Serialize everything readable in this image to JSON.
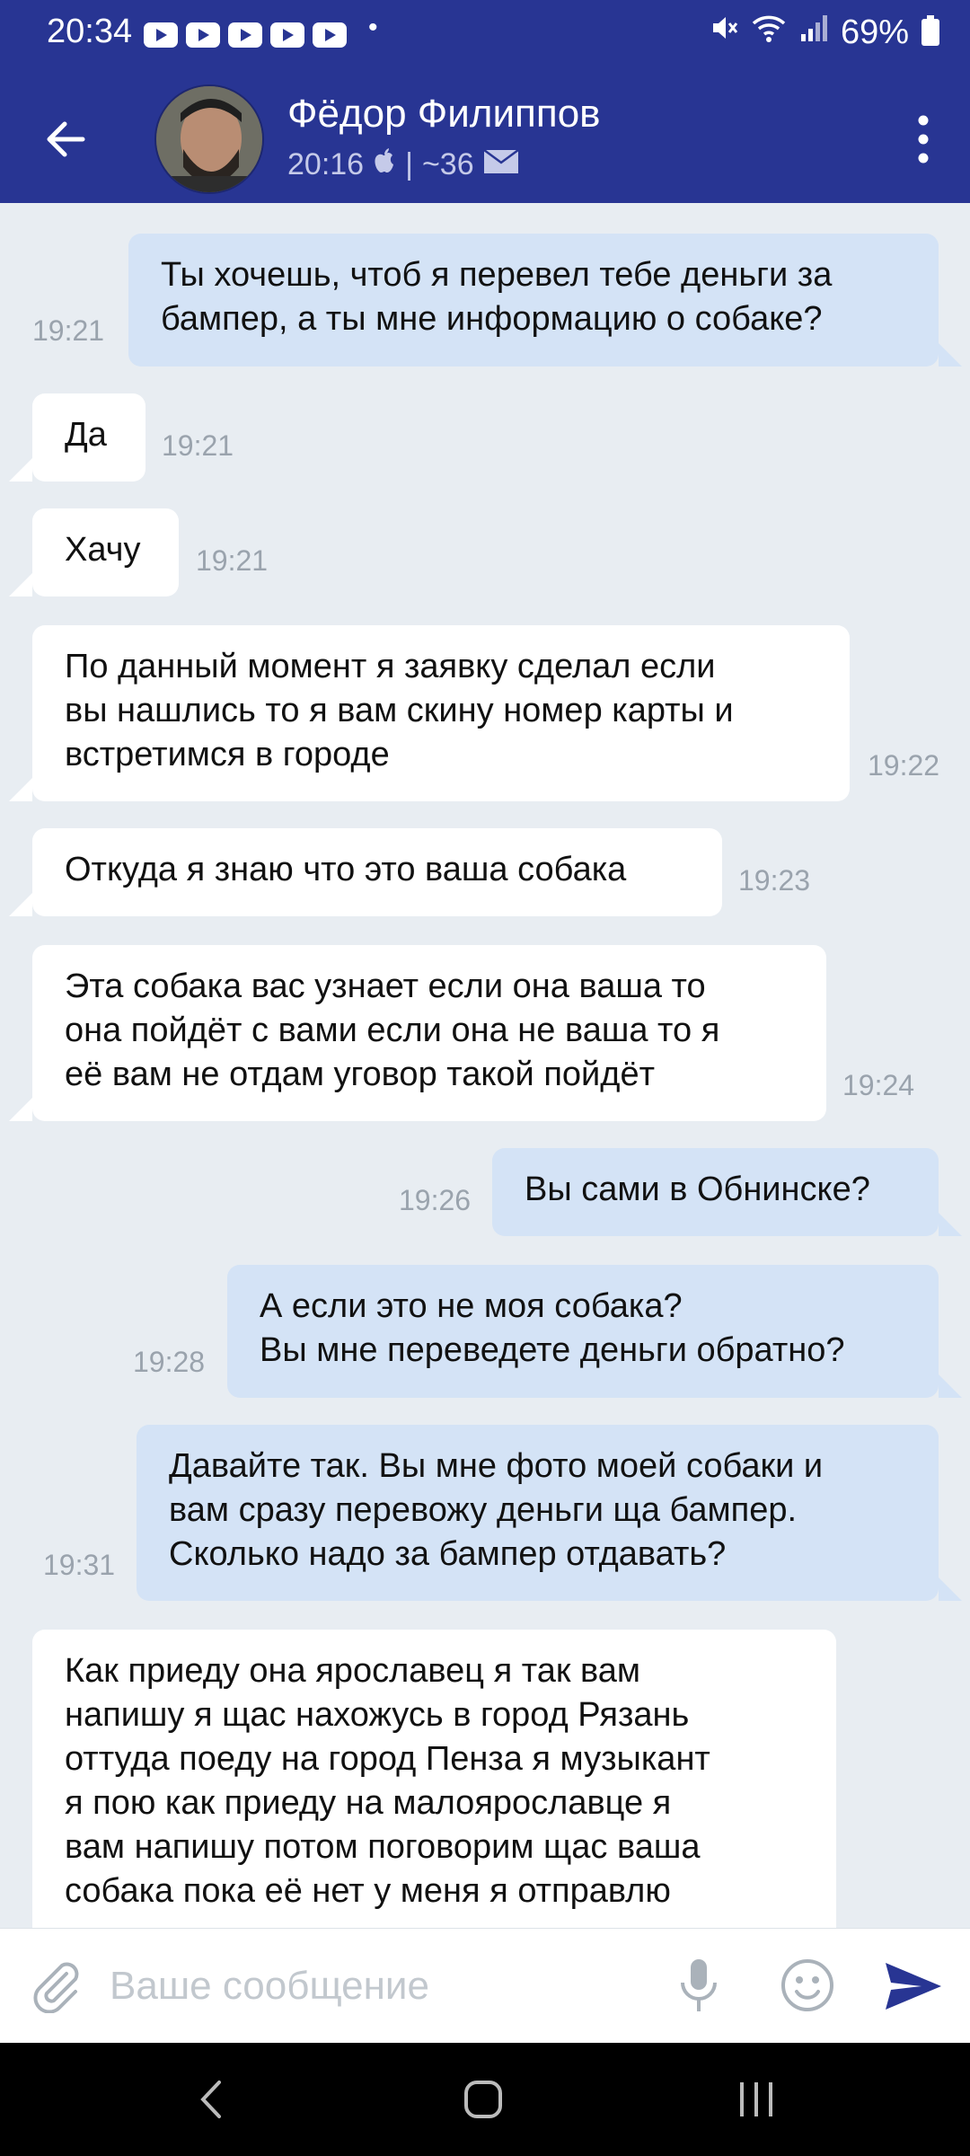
{
  "status_bar": {
    "time": "20:34",
    "dot": "•",
    "battery": "69%"
  },
  "header": {
    "contact_name": "Фёдор Филиппов",
    "last_seen": "20:16",
    "separator": "|",
    "age": "~36"
  },
  "messages": [
    {
      "direction": "out",
      "lines": [
        "Ты хочешь, чтоб я перевел тебе деньги за",
        "бампер, а ты мне информацию о собаке?"
      ],
      "time": "19:21"
    },
    {
      "direction": "in",
      "lines": [
        "Да"
      ],
      "time": "19:21"
    },
    {
      "direction": "in",
      "lines": [
        "Хачу"
      ],
      "time": "19:21"
    },
    {
      "direction": "in",
      "lines": [
        "По данный момент я заявку сделал если",
        "вы нашлись то я вам скину номер карты и",
        "встретимся в городе"
      ],
      "time": "19:22"
    },
    {
      "direction": "in",
      "lines": [
        "Откуда я знаю что это ваша собака"
      ],
      "time": "19:23"
    },
    {
      "direction": "in",
      "lines": [
        "Эта собака вас узнает если она ваша то",
        "она пойдёт с вами если она не ваша то я",
        "её вам не отдам уговор такой пойдёт"
      ],
      "time": "19:24"
    },
    {
      "direction": "out",
      "lines": [
        "Вы сами в Обнинске?"
      ],
      "time": "19:26"
    },
    {
      "direction": "out",
      "lines": [
        "А если это не моя собака?",
        "Вы мне переведете деньги обратно?"
      ],
      "time": "19:28"
    },
    {
      "direction": "out",
      "lines": [
        "Давайте так. Вы мне фото моей собаки и",
        "вам сразу перевожу деньги ща бампер.",
        "Сколько надо за бампер отдавать?"
      ],
      "time": "19:31"
    },
    {
      "direction": "in",
      "lines": [
        "Как приеду она ярославец я так вам",
        "напишу я щас нахожусь в город Рязань",
        "оттуда поеду на город Пенза я музыкант",
        "я пою как приеду на малоярославце я",
        "вам напишу потом поговорим щас ваша",
        "собака пока её нет у меня я отправлю"
      ],
      "time": ""
    }
  ],
  "composer": {
    "placeholder": "Ваше сообщение"
  },
  "icons": {
    "back": "arrow-left-icon",
    "more": "more-vertical-icon",
    "attach": "paperclip-icon",
    "mic": "microphone-icon",
    "emoji": "smiley-icon",
    "send": "send-icon"
  },
  "colors": {
    "header": "#283593",
    "incoming_bubble": "#ffffff",
    "outgoing_bubble": "#d4e3f6",
    "chat_background": "#e8edf2",
    "send_accent": "#283593"
  }
}
